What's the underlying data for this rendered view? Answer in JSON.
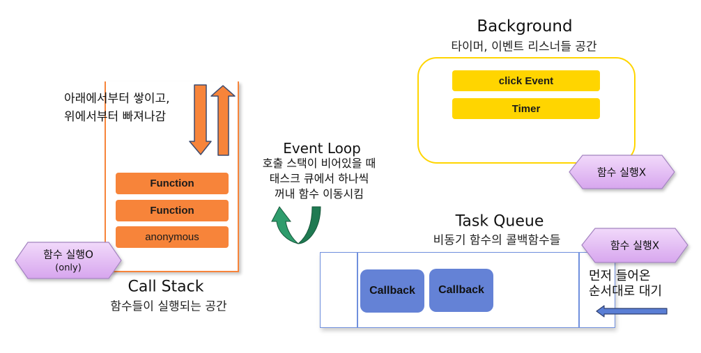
{
  "call_stack": {
    "title": "Call Stack",
    "subtitle": "함수들이 실행되는 공간",
    "note_lines": [
      "아래에서부터 쌓이고,",
      "위에서부터 빠져나감"
    ],
    "frames": [
      "Function",
      "Function",
      "anonymous"
    ],
    "badge": {
      "line1": "함수 실행O",
      "line2": "(only)"
    }
  },
  "event_loop": {
    "title": "Event Loop",
    "desc_lines": [
      "호출 스택이 비어있을 때",
      "태스크 큐에서 하나씩",
      "꺼내 함수 이동시킴"
    ]
  },
  "background": {
    "title": "Background",
    "subtitle": "타이머, 이벤트 리스너들 공간",
    "items": [
      "click Event",
      "Timer"
    ],
    "badge": "함수 실행X"
  },
  "task_queue": {
    "title": "Task Queue",
    "subtitle": "비동기 함수의 콜백함수들",
    "items": [
      "Callback",
      "Callback"
    ],
    "badge": "함수 실행X",
    "note_lines": [
      "먼저 들어온",
      "순서대로 대기"
    ]
  },
  "colors": {
    "call_stack_orange": "#F7843A",
    "background_yellow": "#FFD500",
    "task_queue_blue": "#6482D6",
    "badge_purple": "#E3BFF3",
    "event_loop_green": "#229062"
  }
}
